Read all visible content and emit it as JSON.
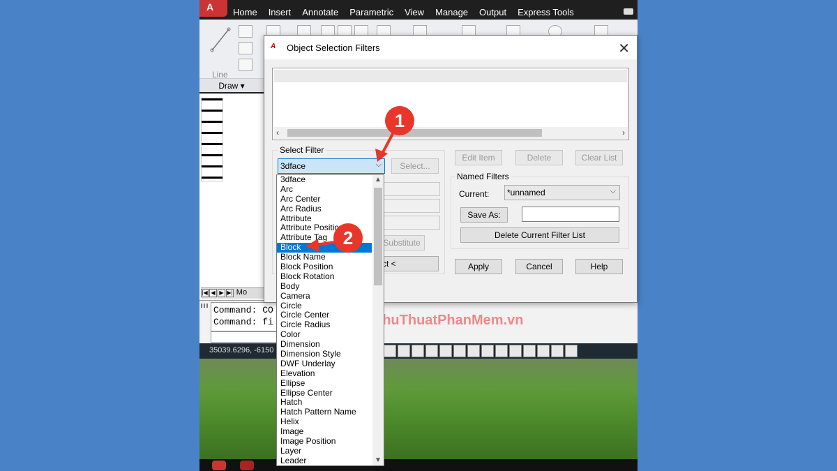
{
  "ribbon": {
    "tabs": [
      "Home",
      "Insert",
      "Annotate",
      "Parametric",
      "View",
      "Manage",
      "Output",
      "Express Tools"
    ],
    "active_tab": "Home",
    "line_label": "Line",
    "draw_panel_label": "Draw ▾"
  },
  "command_window": {
    "lines": [
      "Command: CO",
      "Command: fi"
    ]
  },
  "status_bar": {
    "coordinates": "35039.6296, -6150"
  },
  "layout_tab_label": "Mo",
  "watermark": "ThuThuatPhanMem.vn",
  "dialog": {
    "title": "Object Selection Filters",
    "close_glyph": "✕",
    "select_filter_group": "Select Filter",
    "current_filter_value": "3dface",
    "select_button": "Select...",
    "substitute_button": "Substitute",
    "add_selected_button": "Add Selected Object <",
    "add_selected_visible": "ct <",
    "edit_item_button": "Edit Item",
    "delete_button": "Delete",
    "clear_list_button": "Clear List",
    "named_filters_group": "Named Filters",
    "current_label": "Current:",
    "current_named_value": "*unnamed",
    "save_as_button": "Save As:",
    "save_as_value": "",
    "delete_current_button": "Delete Current Filter List",
    "apply_button": "Apply",
    "cancel_button": "Cancel",
    "help_button": "Help"
  },
  "dropdown": {
    "selected": "Block",
    "items": [
      "3dface",
      "Arc",
      "Arc Center",
      "Arc Radius",
      "Attribute",
      "Attribute Position",
      "Attribute Tag",
      "Block",
      "Block Name",
      "Block Position",
      "Block Rotation",
      "Body",
      "Camera",
      "Circle",
      "Circle Center",
      "Circle Radius",
      "Color",
      "Dimension",
      "Dimension Style",
      "DWF Underlay",
      "Elevation",
      "Ellipse",
      "Ellipse Center",
      "Hatch",
      "Hatch Pattern Name",
      "Helix",
      "Image",
      "Image Position",
      "Layer",
      "Leader"
    ]
  },
  "callouts": [
    "1",
    "2"
  ],
  "colors": {
    "background": "#4a82c8",
    "accent_selection": "#0078d7",
    "callout_red": "#e8372a"
  }
}
